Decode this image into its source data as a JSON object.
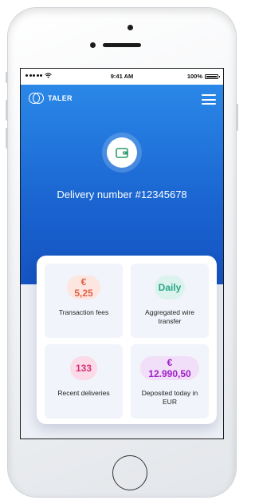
{
  "status_bar": {
    "time": "9:41 AM",
    "battery": "100%"
  },
  "header": {
    "logo_text": "TALER"
  },
  "hero": {
    "title": "Delivery number #12345678"
  },
  "stats": [
    {
      "value": "€ 5,25",
      "label": "Transaction fees",
      "color": "#e0614a",
      "pill_bg": "#fde6df"
    },
    {
      "value": "Daily",
      "label": "Aggregated wire transfer",
      "color": "#2aa68c",
      "pill_bg": "#dbf3ec"
    },
    {
      "value": "133",
      "label": "Recent deliveries",
      "color": "#d6317a",
      "pill_bg": "#fbdbe8"
    },
    {
      "value": "€ 12.990,50",
      "label": "Deposited today in EUR",
      "color": "#a020c8",
      "pill_bg": "#f1def8"
    }
  ],
  "icons": [
    "wallet-icon",
    "menu-icon",
    "wifi-icon",
    "battery-icon",
    "signal-icon"
  ]
}
